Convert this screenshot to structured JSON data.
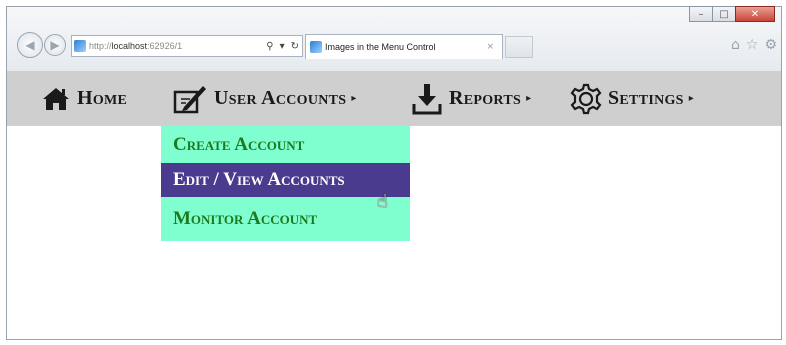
{
  "browser": {
    "url_prefix": "http://",
    "url_host": "localhost",
    "url_rest": ":62926/1",
    "address_icons": [
      "search-icon",
      "refresh-icon"
    ],
    "tab_title": "Images in the Menu Control",
    "tab_close": "×",
    "window_controls": [
      "minimize",
      "maximize",
      "close"
    ],
    "toolbar_icons": [
      "home-icon",
      "favorites-star-icon",
      "gear-icon"
    ]
  },
  "menu": {
    "items": [
      {
        "label": "Home",
        "icon": "home-icon",
        "has_submenu": false
      },
      {
        "label": "User Accounts",
        "icon": "edit-icon",
        "has_submenu": true
      },
      {
        "label": "Reports",
        "icon": "download-icon",
        "has_submenu": true
      },
      {
        "label": "Settings",
        "icon": "gear-icon",
        "has_submenu": true
      }
    ],
    "submenu_arrow": "▸"
  },
  "dropdown": {
    "items": [
      {
        "label": "Create Account"
      },
      {
        "label": "Edit / View Accounts",
        "active": true
      },
      {
        "label": "Monitor Account"
      }
    ]
  },
  "colors": {
    "menubar_bg": "#cfcfcf",
    "dropdown_bg": "#7fffd0",
    "dropdown_text": "#1d7a1d",
    "dropdown_active_bg": "#4b3b8e",
    "dropdown_active_text": "#ffffff"
  }
}
